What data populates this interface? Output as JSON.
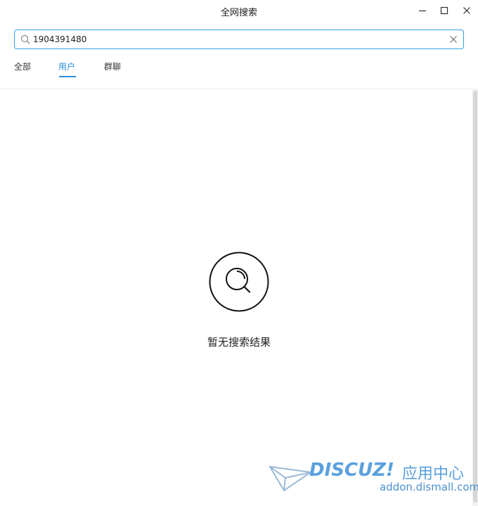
{
  "window": {
    "title": "全网搜索"
  },
  "search": {
    "value": "1904391480",
    "placeholder": ""
  },
  "tabs": [
    {
      "label": "全部",
      "active": false
    },
    {
      "label": "用户",
      "active": true
    },
    {
      "label": "群聊",
      "active": false
    }
  ],
  "empty_state": {
    "message": "暂无搜索结果",
    "icon": "search-icon"
  },
  "watermark": {
    "brand": "DISCUZ!",
    "brand_cn": "应用中心",
    "url": "addon.dismall.com"
  },
  "colors": {
    "accent": "#2b8fd9",
    "search_border": "#2f9fe3",
    "watermark": "#5aa0de"
  }
}
